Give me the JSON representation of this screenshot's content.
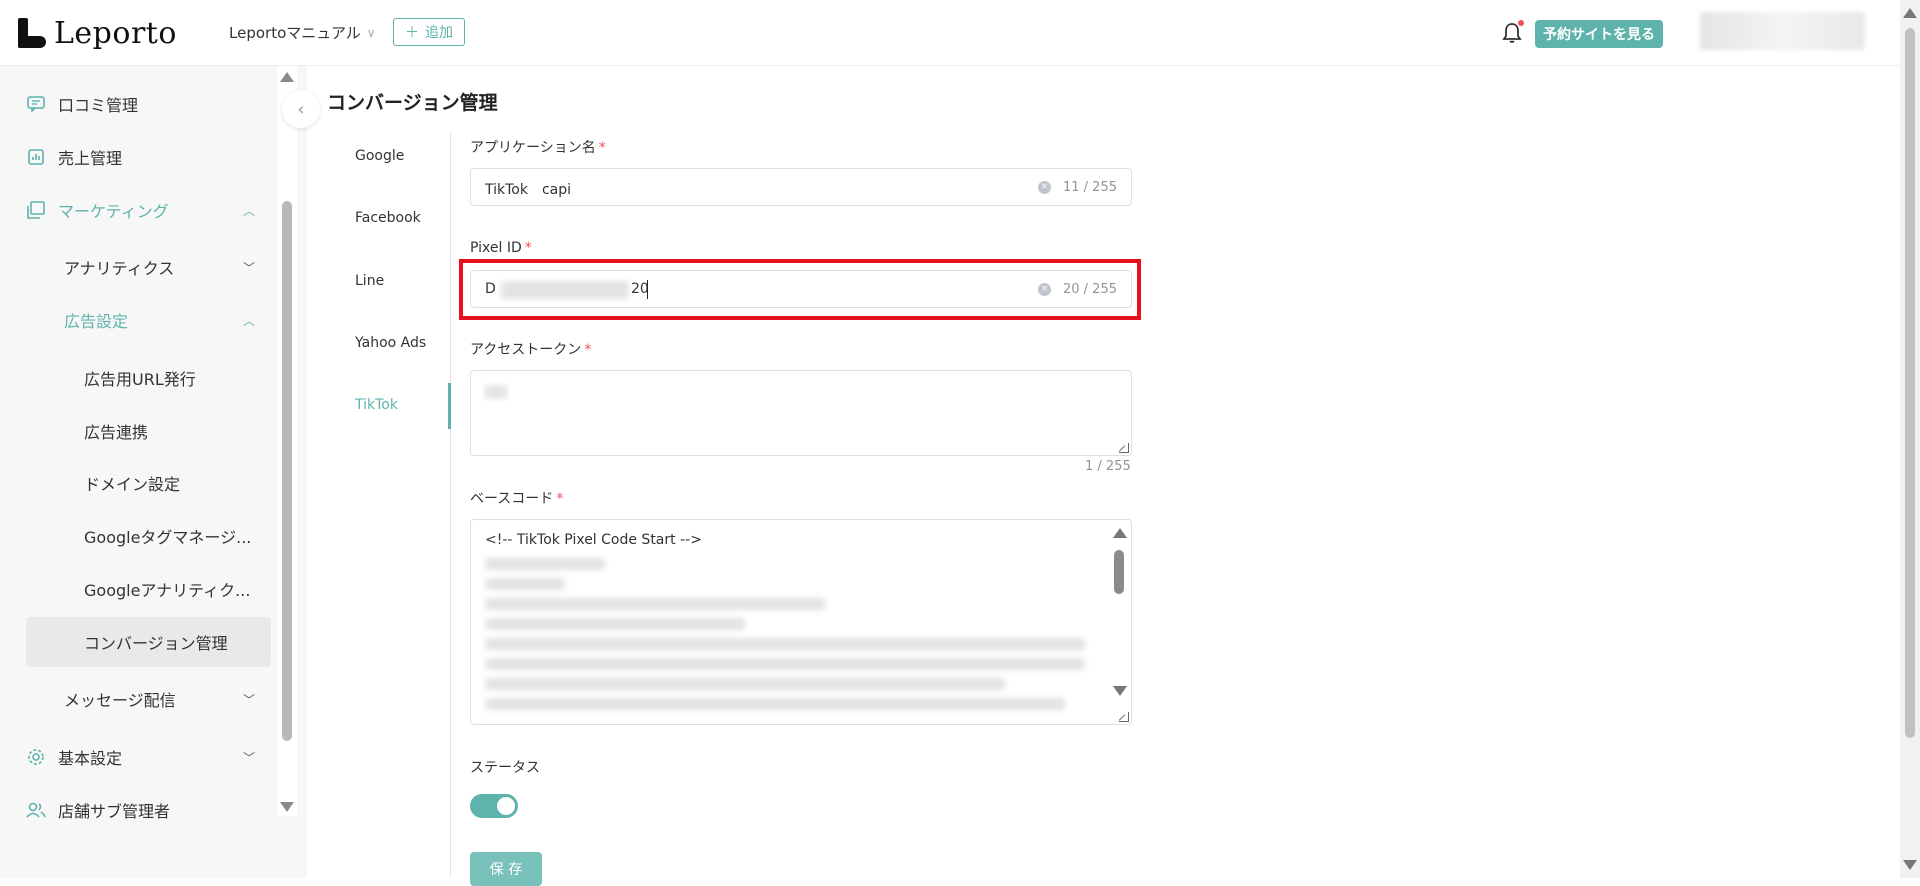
{
  "header": {
    "logo_text": "Leporto",
    "site_selector": "Leportoマニュアル",
    "add_label": "追加",
    "view_site_label": "予約サイトを見る"
  },
  "sidebar": {
    "items": [
      {
        "label": "口コミ管理",
        "icon": "comment-icon"
      },
      {
        "label": "売上管理",
        "icon": "chart-icon"
      },
      {
        "label": "マーケティング",
        "icon": "layers-icon"
      },
      {
        "label": "アナリティクス"
      },
      {
        "label": "広告設定"
      },
      {
        "label": "広告用URL発行"
      },
      {
        "label": "広告連携"
      },
      {
        "label": "ドメイン設定"
      },
      {
        "label": "Googleタグマネージ..."
      },
      {
        "label": "Googleアナリティク..."
      },
      {
        "label": "コンバージョン管理"
      },
      {
        "label": "メッセージ配信"
      },
      {
        "label": "基本設定",
        "icon": "gear-icon"
      },
      {
        "label": "店舗サブ管理者",
        "icon": "users-icon"
      }
    ]
  },
  "main": {
    "title": "コンバージョン管理",
    "tabs": [
      "Google",
      "Facebook",
      "Line",
      "Yahoo Ads",
      "TikTok"
    ],
    "active_tab": "TikTok",
    "form": {
      "app_name_label": "アプリケーション名",
      "app_name_value": "TikTok　capi",
      "app_name_count": "11 / 255",
      "pixel_id_label": "Pixel ID",
      "pixel_id_prefix": "D",
      "pixel_id_suffix": "20",
      "pixel_id_count": "20 / 255",
      "access_token_label": "アクセストークン",
      "access_token_count": "1 / 255",
      "base_code_label": "ベースコード",
      "base_code_first_line": "<!-- TikTok Pixel Code Start -->",
      "status_label": "ステータス",
      "status_on": true,
      "save_label": "保 存"
    }
  },
  "colors": {
    "accent": "#5fb3ad",
    "highlight": "#e8101b",
    "required": "#f05050"
  }
}
